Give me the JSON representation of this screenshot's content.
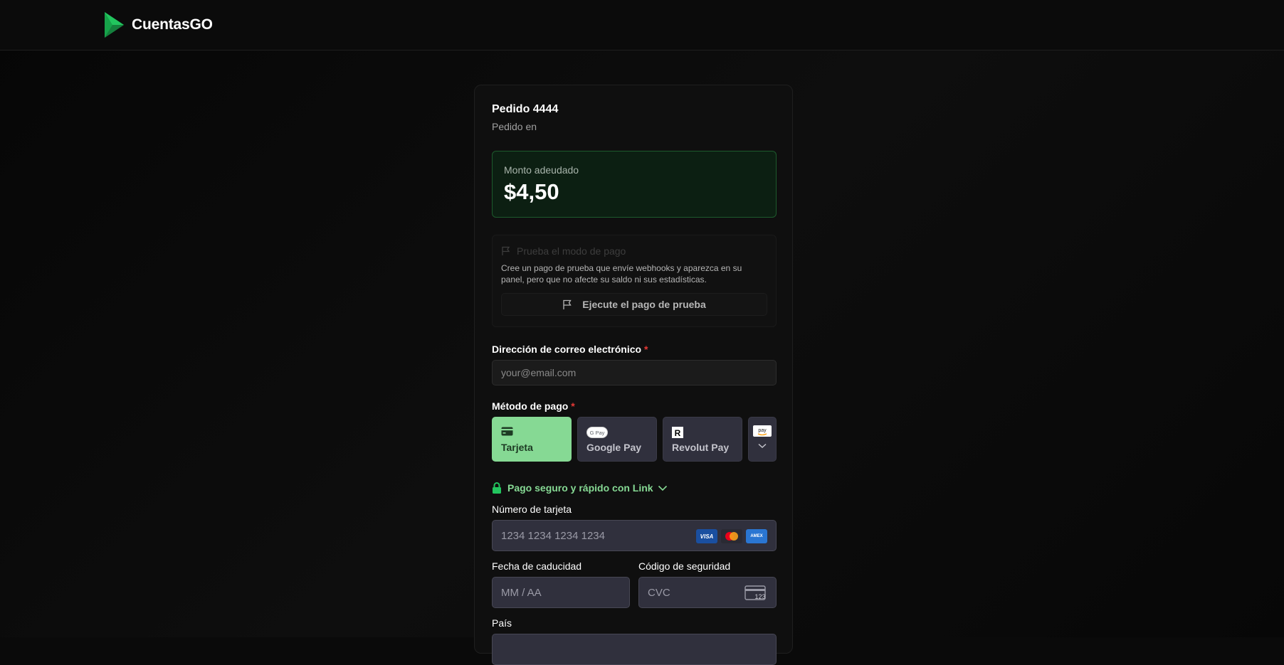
{
  "header": {
    "brand_name": "CuentasGO",
    "logo_icon": "green-play-triangle"
  },
  "order": {
    "title": "Pedido 4444",
    "subtitle": "Pedido en"
  },
  "amount": {
    "label": "Monto adeudado",
    "value": "$4,50"
  },
  "test_mode": {
    "heading": "Prueba el modo de pago",
    "description": "Cree un pago de prueba que envíe webhooks y aparezca en su panel, pero que no afecte su saldo ni sus estadísticas.",
    "button_label": "Ejecute el pago de prueba"
  },
  "email": {
    "label": "Dirección de correo electrónico",
    "required_mark": "*",
    "placeholder": "your@email.com"
  },
  "payment_method": {
    "label": "Método de pago",
    "required_mark": "*",
    "options": [
      {
        "label": "Tarjeta",
        "icon": "card-icon",
        "selected": true
      },
      {
        "label": "Google Pay",
        "icon": "google-pay-icon",
        "selected": false
      },
      {
        "label": "Revolut Pay",
        "icon": "revolut-icon",
        "selected": false
      }
    ],
    "more_icon": "amazon-pay-icon"
  },
  "link": {
    "label": "Pago seguro y rápido con Link"
  },
  "card_form": {
    "number_label": "Número de tarjeta",
    "number_placeholder": "1234 1234 1234 1234",
    "brands": [
      "VISA",
      "Mastercard",
      "AMEX"
    ],
    "expiry_label": "Fecha de caducidad",
    "expiry_placeholder": "MM / AA",
    "cvc_label": "Código de seguridad",
    "cvc_placeholder": "CVC",
    "country_label": "País"
  },
  "colors": {
    "accent_green": "#86d994",
    "amount_border": "#1d5a2c",
    "background": "#0a0a0a"
  }
}
